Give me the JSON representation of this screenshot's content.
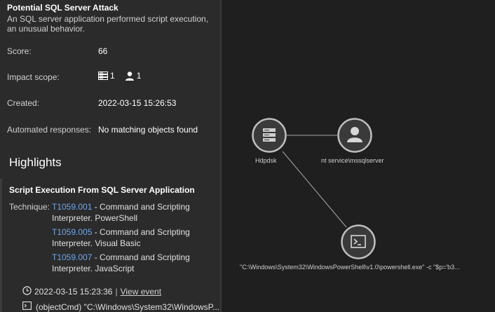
{
  "alert": {
    "title": "Potential SQL Server Attack",
    "description": "An SQL server application performed script execution, an unusual behavior."
  },
  "details": {
    "score_label": "Score:",
    "score_value": "66",
    "impact_label": "Impact scope:",
    "impact_devices": "1",
    "impact_users": "1",
    "created_label": "Created:",
    "created_value": "2022-03-15 15:26:53",
    "responses_label": "Automated responses:",
    "responses_value": "No matching objects found"
  },
  "highlights": {
    "heading": "Highlights",
    "item_title": "Script Execution From SQL Server Application",
    "technique_label": "Technique:",
    "techniques": [
      {
        "id": "T1059.001",
        "text": " - Command and Scripting Interpreter. PowerShell"
      },
      {
        "id": "T1059.005",
        "text": " - Command and Scripting Interpreter. Visual Basic"
      },
      {
        "id": "T1059.007",
        "text": " - Command and Scripting Interpreter. JavaScript"
      }
    ],
    "event_time": "2022-03-15 15:23:36",
    "event_sep": "|",
    "event_link": "View event",
    "command": "(objectCmd) \"C:\\Windows\\System32\\WindowsP..."
  },
  "graph": {
    "server_label": "Hdpdsk",
    "user_label": "nt service\\mssqlserver",
    "process_label": "\"C:\\Windows\\System32\\WindowsPowerShell\\v1.0\\powershell.exe\" -c \"$p='b3..."
  },
  "icons": {
    "server": "server-icon",
    "user": "user-icon",
    "terminal": "terminal-icon",
    "clock": "clock-icon"
  },
  "colors": {
    "panel_bg": "#2b2b2b",
    "graph_bg": "#1f1f1f",
    "link": "#6ea6e8",
    "node_stroke": "#bdbdbd",
    "node_fill": "#3a3a3a"
  }
}
